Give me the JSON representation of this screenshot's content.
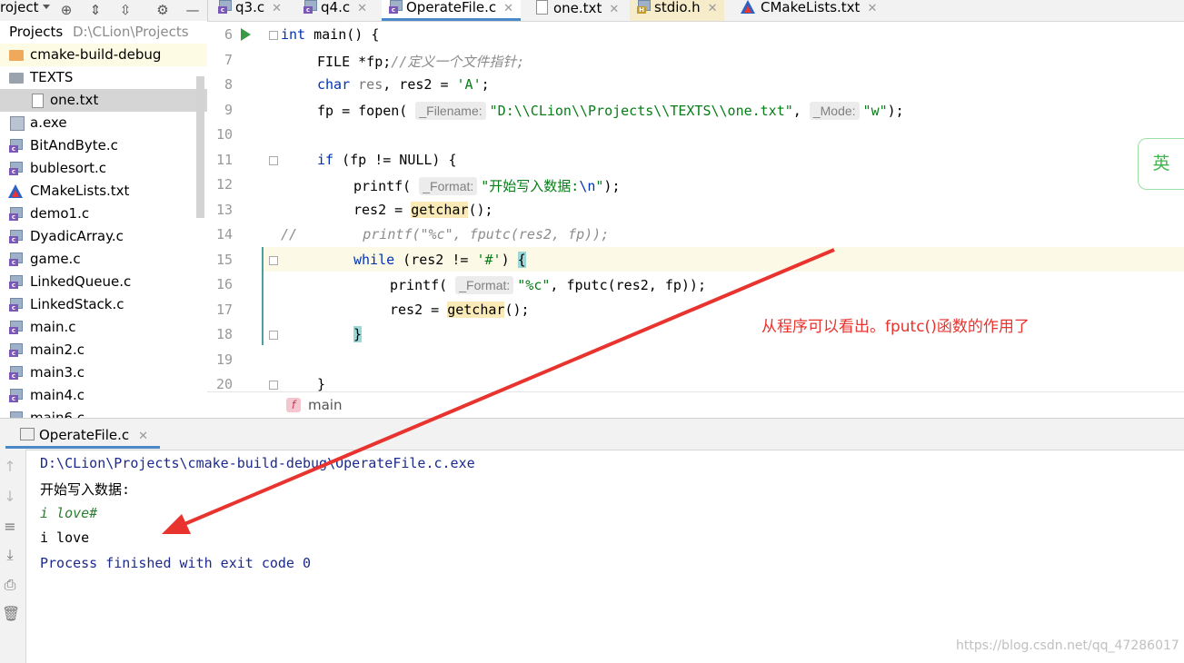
{
  "toolbar": {
    "project_label": "roject",
    "tabs": [
      {
        "label": "q3.c",
        "icon": "c-file-icon"
      },
      {
        "label": "q4.c",
        "icon": "c-file-icon"
      },
      {
        "label": "OperateFile.c",
        "icon": "c-file-icon",
        "active": true
      },
      {
        "label": "one.txt",
        "icon": "text-file-icon"
      },
      {
        "label": "stdio.h",
        "icon": "h-file-icon"
      },
      {
        "label": "CMakeLists.txt",
        "icon": "cmake-icon"
      }
    ],
    "close_glyph": "✕"
  },
  "tree": {
    "root_label": "Projects",
    "root_path": "D:\\CLion\\Projects",
    "items": [
      {
        "label": "cmake-build-debug",
        "type": "folder"
      },
      {
        "label": "TEXTS",
        "type": "folder"
      },
      {
        "label": "one.txt",
        "type": "text"
      },
      {
        "label": "a.exe",
        "type": "exe"
      },
      {
        "label": "BitAndByte.c",
        "type": "c"
      },
      {
        "label": "bublesort.c",
        "type": "c"
      },
      {
        "label": "CMakeLists.txt",
        "type": "cmake"
      },
      {
        "label": "demo1.c",
        "type": "c"
      },
      {
        "label": "DyadicArray.c",
        "type": "c"
      },
      {
        "label": "game.c",
        "type": "c"
      },
      {
        "label": "LinkedQueue.c",
        "type": "c"
      },
      {
        "label": "LinkedStack.c",
        "type": "c"
      },
      {
        "label": "main.c",
        "type": "c"
      },
      {
        "label": "main2.c",
        "type": "c"
      },
      {
        "label": "main3.c",
        "type": "c"
      },
      {
        "label": "main4.c",
        "type": "c"
      },
      {
        "label": "main6.c",
        "type": "c"
      }
    ]
  },
  "editor": {
    "line_numbers": [
      "6",
      "7",
      "8",
      "9",
      "10",
      "11",
      "12",
      "13",
      "14",
      "15",
      "16",
      "17",
      "18",
      "19",
      "20"
    ],
    "code": {
      "l6_int": "int",
      "l6_rest": " main() {",
      "l7_a": "FILE *fp;",
      "l7_cm": "//定义一个文件指针;",
      "l8_kw": "char",
      "l8_res": " res",
      "l8_rest": ", res2 = ",
      "l8_str": "'A'",
      "l8_end": ";",
      "l9_a": "fp = fopen(",
      "l9_hint1": "_Filename:",
      "l9_str": "\"D:\\\\CLion\\\\Projects\\\\TEXTS\\\\one.txt\"",
      "l9_comma": ", ",
      "l9_hint2": "_Mode:",
      "l9_str2": "\"w\"",
      "l9_end": ");",
      "l11_kw": "if",
      "l11_rest": " (fp != NULL) {",
      "l12_a": "printf(",
      "l12_hint": "_Format:",
      "l12_str": "\"开始写入数据:",
      "l12_esc": "\\n",
      "l12_strend": "\"",
      "l12_end": ");",
      "l13_a": "res2 = ",
      "l13_fn": "getchar",
      "l13_end": "();",
      "l14_cm": "//        printf(\"%c\", fputc(res2, fp));",
      "l15_kw": "while",
      "l15_a": " (res2 != ",
      "l15_str": "'#'",
      "l15_b": ") ",
      "l15_brace": "{",
      "l16_a": "printf(",
      "l16_hint": "_Format:",
      "l16_str": "\"%c\"",
      "l16_end": ", fputc(res2, fp));",
      "l17_a": "res2 = ",
      "l17_fn": "getchar",
      "l17_end": "();",
      "l18_brace": "}",
      "l20_brace": "}"
    },
    "breadcrumb_icon": "f",
    "breadcrumb_label": "main"
  },
  "run": {
    "tab_label": "OperateFile.c",
    "output": [
      {
        "text": "D:\\CLion\\Projects\\cmake-build-debug\\OperateFile.c.exe",
        "kind": "path"
      },
      {
        "text": "开始写入数据:",
        "kind": "stdout"
      },
      {
        "text": "i love#",
        "kind": "input"
      },
      {
        "text": "i love",
        "kind": "stdout"
      },
      {
        "text": "Process finished with exit code 0",
        "kind": "system"
      }
    ]
  },
  "overlay": {
    "annotation": "从程序可以看出。fputc()函数的作用了",
    "ime_label": "英",
    "watermark": "https://blog.csdn.net/qq_47286017"
  },
  "colors": {
    "keyword": "#0033b3",
    "string": "#067d17",
    "annotation": "#e8332e",
    "ime": "#3cb54a"
  }
}
